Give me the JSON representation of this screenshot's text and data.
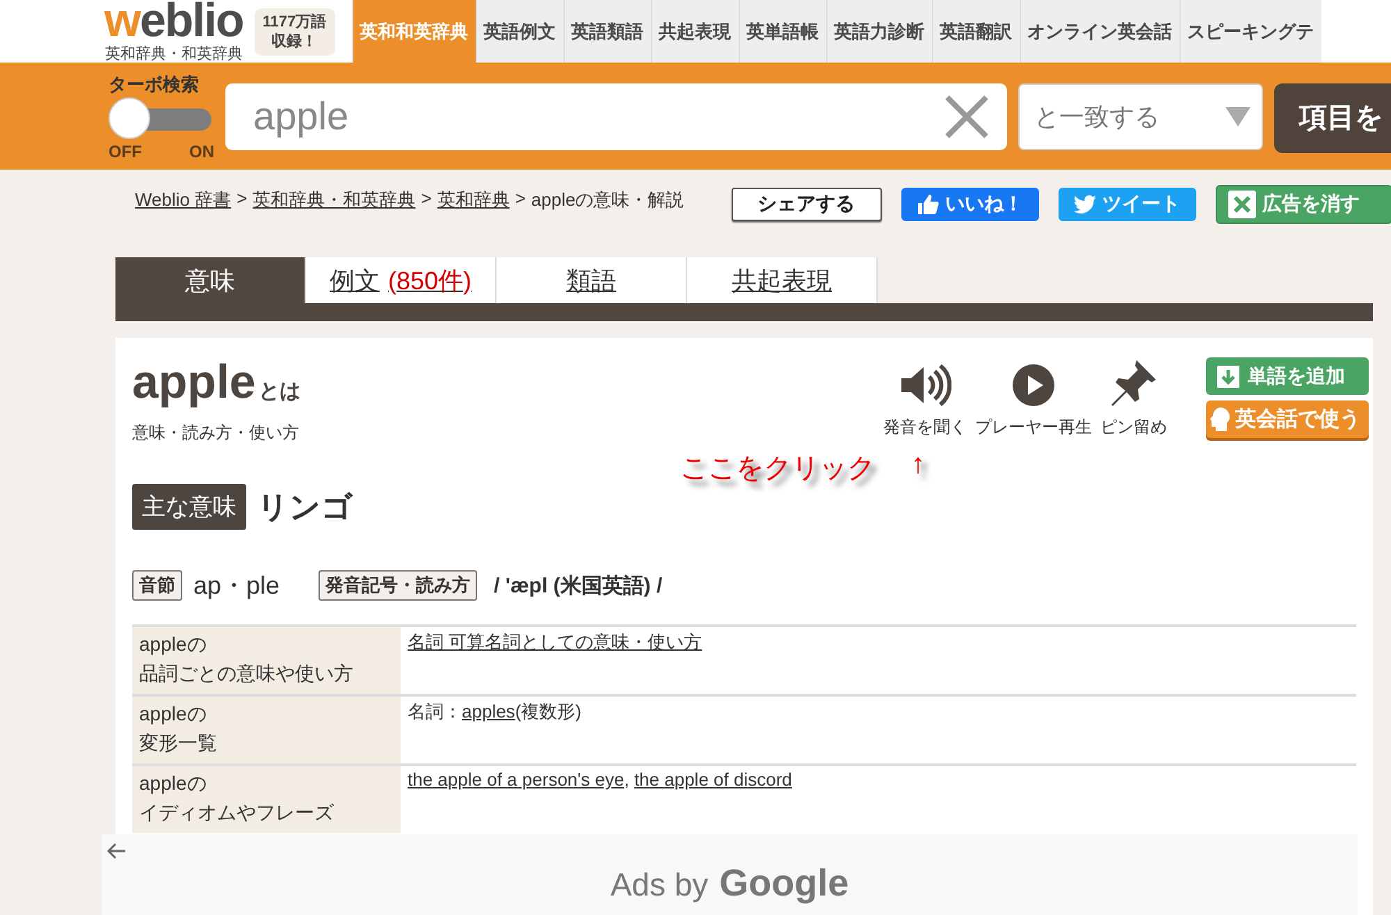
{
  "header": {
    "logo": "weblio",
    "logo_subtitle": "英和辞典・和英辞典",
    "badge": [
      "1177万語",
      "収録！"
    ]
  },
  "nav": [
    {
      "label": "英和和英辞典",
      "selected": true
    },
    {
      "label": "英語例文",
      "selected": false
    },
    {
      "label": "英語類語",
      "selected": false
    },
    {
      "label": "共起表現",
      "selected": false
    },
    {
      "label": "英単語帳",
      "selected": false
    },
    {
      "label": "英語力診断",
      "selected": false
    },
    {
      "label": "英語翻訳",
      "selected": false
    },
    {
      "label": "オンライン英会話",
      "selected": false
    },
    {
      "label": "スピーキングテ",
      "selected": false
    }
  ],
  "search": {
    "turbo_label": "ターボ検索",
    "turbo_on": false,
    "off_label": "OFF",
    "on_label": "ON",
    "value": "apple",
    "match": "と一致する",
    "submit": "項目を"
  },
  "breadcrumbs": {
    "separator": ">",
    "items": [
      {
        "text": "Weblio 辞書",
        "link": true
      },
      {
        "text": "英和辞典・和英辞典",
        "link": true
      },
      {
        "text": "英和辞典",
        "link": true
      },
      {
        "text": "appleの意味・解説",
        "link": false
      }
    ]
  },
  "share_buttons": [
    {
      "kind": "share",
      "label": "シェアする"
    },
    {
      "kind": "like",
      "label": "いいね！"
    },
    {
      "kind": "tweet",
      "label": "ツイート"
    },
    {
      "kind": "hide_ads",
      "label": "広告を消す"
    }
  ],
  "tabs": [
    {
      "label": "意味",
      "selected": true
    },
    {
      "label": "例文",
      "count": "(850件)",
      "selected": false
    },
    {
      "label": "類語",
      "selected": false
    },
    {
      "label": "共起表現",
      "selected": false
    }
  ],
  "entry": {
    "word": "apple",
    "suffix": "とは",
    "subtitle": "意味・読み方・使い方",
    "tools": [
      {
        "kind": "speaker",
        "label": "発音を聞く"
      },
      {
        "kind": "play",
        "label": "プレーヤー再生"
      },
      {
        "kind": "pin",
        "label": "ピン留め"
      }
    ],
    "actions": [
      {
        "kind": "add",
        "label": "単語を追加"
      },
      {
        "kind": "conversation",
        "label": "英会話で使う"
      }
    ],
    "annotation": {
      "text": "ここをクリック",
      "arrow": "↑"
    },
    "main_meaning": {
      "tag": "主な意味",
      "text": "リンゴ"
    },
    "syllables": {
      "tag": "音節",
      "text": "ap・ple"
    },
    "pronunciation": {
      "tag": "発音記号・読み方",
      "text": "/ 'æpl (米国英語) /"
    }
  },
  "table": [
    {
      "heading": [
        "appleの",
        "品詞ごとの意味や使い方"
      ],
      "parts": [
        {
          "text": "名詞 可算名詞としての意味・使い方",
          "link": true
        }
      ]
    },
    {
      "heading": [
        "appleの",
        "変形一覧"
      ],
      "parts": [
        {
          "text": "名詞：",
          "link": false
        },
        {
          "text": "apples",
          "link": true
        },
        {
          "text": "(複数形)",
          "link": false
        }
      ]
    },
    {
      "heading": [
        "appleの",
        "イディオムやフレーズ"
      ],
      "parts": [
        {
          "text": "the apple of a person's eye",
          "link": true
        },
        {
          "text": ", ",
          "link": false
        },
        {
          "text": "the apple of discord",
          "link": true
        }
      ]
    }
  ],
  "ad": {
    "prefix": "Ads by",
    "brand": "Google"
  }
}
